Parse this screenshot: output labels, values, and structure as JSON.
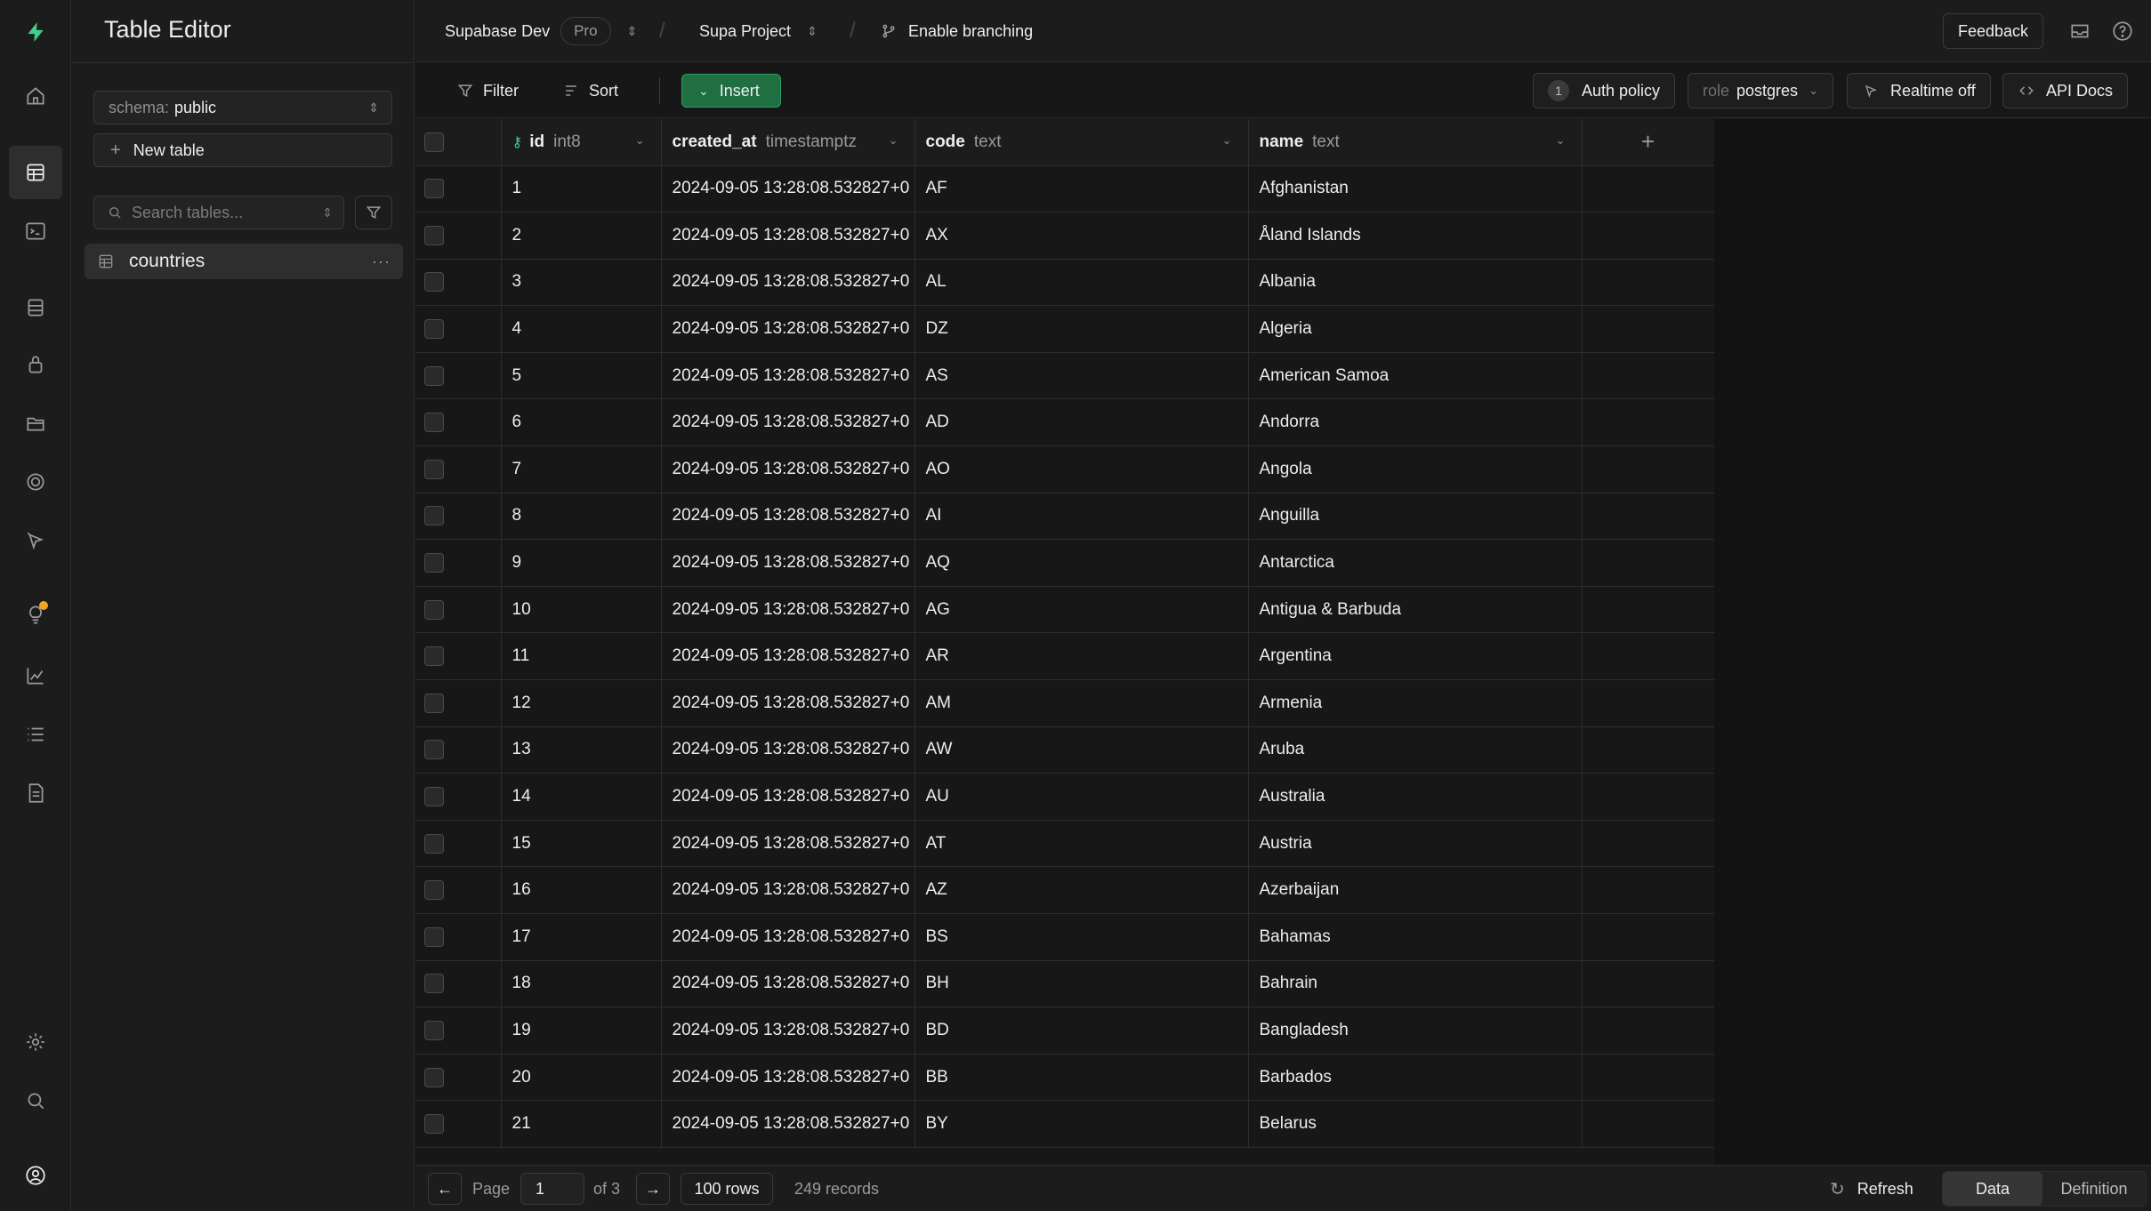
{
  "sidebar": {
    "title": "Table Editor",
    "schema_label": "schema:",
    "schema_value": "public",
    "new_table": "New table",
    "search_placeholder": "Search tables...",
    "table_item": "countries"
  },
  "topbar": {
    "org": "Supabase Dev",
    "plan": "Pro",
    "project": "Supa Project",
    "branching": "Enable branching",
    "feedback": "Feedback"
  },
  "toolbar": {
    "filter": "Filter",
    "sort": "Sort",
    "insert": "Insert",
    "auth_count": "1",
    "auth_policy": "Auth policy",
    "role_label": "role",
    "role_value": "postgres",
    "realtime": "Realtime off",
    "api_docs": "API Docs"
  },
  "grid": {
    "columns": [
      {
        "name": "id",
        "type": "int8"
      },
      {
        "name": "created_at",
        "type": "timestamptz"
      },
      {
        "name": "code",
        "type": "text"
      },
      {
        "name": "name",
        "type": "text"
      }
    ],
    "timestamp": "2024-09-05 13:28:08.532827+0",
    "rows": [
      [
        "1",
        "AF",
        "Afghanistan"
      ],
      [
        "2",
        "AX",
        "Åland Islands"
      ],
      [
        "3",
        "AL",
        "Albania"
      ],
      [
        "4",
        "DZ",
        "Algeria"
      ],
      [
        "5",
        "AS",
        "American Samoa"
      ],
      [
        "6",
        "AD",
        "Andorra"
      ],
      [
        "7",
        "AO",
        "Angola"
      ],
      [
        "8",
        "AI",
        "Anguilla"
      ],
      [
        "9",
        "AQ",
        "Antarctica"
      ],
      [
        "10",
        "AG",
        "Antigua & Barbuda"
      ],
      [
        "11",
        "AR",
        "Argentina"
      ],
      [
        "12",
        "AM",
        "Armenia"
      ],
      [
        "13",
        "AW",
        "Aruba"
      ],
      [
        "14",
        "AU",
        "Australia"
      ],
      [
        "15",
        "AT",
        "Austria"
      ],
      [
        "16",
        "AZ",
        "Azerbaijan"
      ],
      [
        "17",
        "BS",
        "Bahamas"
      ],
      [
        "18",
        "BH",
        "Bahrain"
      ],
      [
        "19",
        "BD",
        "Bangladesh"
      ],
      [
        "20",
        "BB",
        "Barbados"
      ],
      [
        "21",
        "BY",
        "Belarus"
      ]
    ]
  },
  "footer": {
    "page_label": "Page",
    "page_value": "1",
    "of_pages": "of 3",
    "rows_per_page": "100 rows",
    "records": "249 records",
    "refresh": "Refresh",
    "tab_data": "Data",
    "tab_definition": "Definition"
  },
  "colors": {
    "accent": "#3ecf8e",
    "insert_bg": "#1f6f43",
    "notification": "#f5a524"
  },
  "icons": [
    "supabase-logo-icon",
    "home-icon",
    "table-editor-icon",
    "sql-editor-icon",
    "database-icon",
    "auth-lock-icon",
    "storage-icon",
    "edge-functions-icon",
    "realtime-icon",
    "advisors-icon",
    "reports-icon",
    "logs-icon",
    "api-docs-icon",
    "settings-icon",
    "search-icon",
    "user-avatar-icon"
  ]
}
